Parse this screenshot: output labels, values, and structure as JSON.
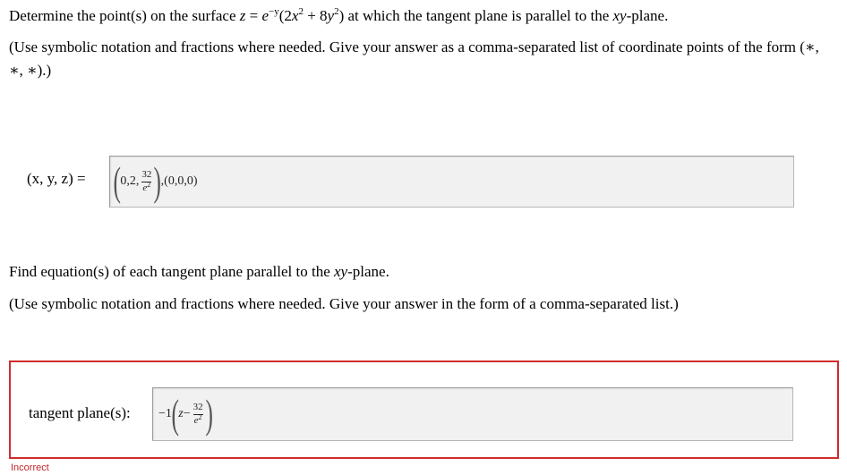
{
  "question1": {
    "prompt_start": "Determine the point(s) on the surface ",
    "equation_z": "z",
    "equation_eq": " = ",
    "equation_e": "e",
    "equation_exp": "−y",
    "equation_body_1": "(2",
    "equation_x": "x",
    "equation_sq1": "2",
    "equation_plus": " + 8",
    "equation_y": "y",
    "equation_sq2": "2",
    "equation_body_2": ")",
    "prompt_end": " at which the tangent plane is parallel to the ",
    "plane": "xy",
    "plane_suffix": "-plane.",
    "note": "(Use symbolic notation and fractions where needed. Give your answer as a comma-separated list of coordinate points of the form (∗, ∗, ∗).)",
    "answer_label": "(x, y, z) =",
    "answer": {
      "lead": "0,2,",
      "frac_num": "32",
      "frac_den_base": "e",
      "frac_den_exp": "2",
      "tail": ",(0,0,0)"
    }
  },
  "question2": {
    "prompt": "Find equation(s) of each tangent plane parallel to the ",
    "plane": "xy",
    "plane_suffix": "-plane.",
    "note": "(Use symbolic notation and fractions where needed. Give your answer in the form of a comma-separated list.)",
    "answer_label": "tangent plane(s):",
    "answer": {
      "lead": "−1",
      "var": "z",
      "minus": " − ",
      "frac_num": "32",
      "frac_den_base": "e",
      "frac_den_exp": "2"
    },
    "status": "Incorrect"
  },
  "colors": {
    "incorrect": "#d22b2b",
    "input_bg": "#f1f1f1"
  }
}
